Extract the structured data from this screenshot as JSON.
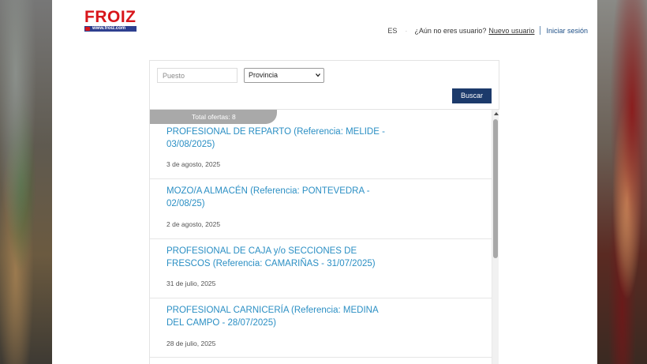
{
  "header": {
    "logo_text": "FROIZ",
    "logo_url_text": "www.froiz.com",
    "language": "ES",
    "separator": "·",
    "no_user_prompt": "¿Aún no eres usuario?",
    "new_user_link": "Nuevo usuario",
    "login_link": "Iniciar sesión"
  },
  "search": {
    "position_placeholder": "Puesto",
    "province_selected": "Provincia",
    "search_button": "Buscar"
  },
  "results": {
    "total_label": "Total ofertas: 8",
    "offers": [
      {
        "title": "PROFESIONAL DE REPARTO (Referencia: MELIDE - 03/08/2025)",
        "date": "3 de agosto, 2025"
      },
      {
        "title": "MOZO/A ALMACÉN (Referencia: PONTEVEDRA - 02/08/25)",
        "date": "2 de agosto, 2025"
      },
      {
        "title": "PROFESIONAL DE CAJA y/o SECCIONES DE FRESCOS (Referencia: CAMARIÑAS - 31/07/2025)",
        "date": "31 de julio, 2025"
      },
      {
        "title": "PROFESIONAL CARNICERÍA (Referencia: MEDINA DEL CAMPO - 28/07/2025)",
        "date": "28 de julio, 2025"
      }
    ]
  }
}
